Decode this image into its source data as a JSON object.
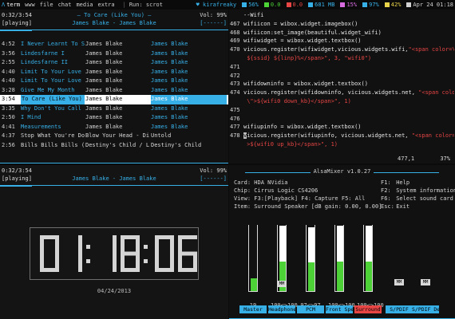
{
  "topbar": {
    "layout_symbol": "Λ",
    "tags": [
      "term",
      "www",
      "file",
      "chat",
      "media",
      "extra"
    ],
    "run_prompt": "Run: scrot",
    "user": "kirafreaky",
    "indicators": [
      {
        "text": "56%",
        "color": "#37b0e8"
      },
      {
        "text": "0.0",
        "color": "#4cd137"
      },
      {
        "text": "0.0",
        "color": "#e84545"
      },
      {
        "text": "681 MB",
        "color": "#37b0e8"
      },
      {
        "text": "15%",
        "color": "#d86be0"
      },
      {
        "text": "97%",
        "color": "#37b0e8"
      },
      {
        "text": "42%",
        "color": "#e8d24a"
      },
      {
        "text": "Apr 24 01:18",
        "color": "#d0d0d0"
      }
    ]
  },
  "music": {
    "time": "0:32/3:54",
    "title": "To Care (Like You)",
    "volume": "Vol: 99%",
    "artist_line": "James Blake - James Blake",
    "status": "[playing]",
    "progress_marker": "[------]",
    "playlist": [
      {
        "time": "4:52",
        "name": "I Never Learnt To Shar",
        "artist": "James Blake",
        "album": "James Blake"
      },
      {
        "time": "3:56",
        "name": "Lindesfarne I",
        "artist": "James Blake",
        "album": "James Blake"
      },
      {
        "time": "2:55",
        "name": "Lindesfarne II",
        "artist": "James Blake",
        "album": "James Blake"
      },
      {
        "time": "4:40",
        "name": "Limit To Your Love",
        "artist": "James Blake",
        "album": "James Blake"
      },
      {
        "time": "4:40",
        "name": "Limit To Your Love",
        "artist": "James Blake",
        "album": "James Blake"
      },
      {
        "time": "3:28",
        "name": "Give Me My Month",
        "artist": "James Blake",
        "album": "James Blake"
      },
      {
        "time": "3:54",
        "name": "To Care (Like You)",
        "artist": "James Blake",
        "album": "James Blake"
      },
      {
        "time": "3:35",
        "name": "Why Don't You Call Me",
        "artist": "James Blake",
        "album": "James Blake"
      },
      {
        "time": "2:50",
        "name": "I Mind",
        "artist": "James Blake",
        "album": "James Blake"
      },
      {
        "time": "4:41",
        "name": "Measurements",
        "artist": "James Blake",
        "album": "James Blake"
      },
      {
        "time": "4:37",
        "name": "Stop What You're Doing",
        "artist": "Blow Your Head - Diplo",
        "album": "Untold"
      },
      {
        "time": "2:56",
        "name": "Bills Bills Bills (Ref",
        "artist": "Destiny's Child / Lil",
        "album": "Destiny's Child"
      }
    ],
    "selected_index": 6
  },
  "music2": {
    "time": "0:32/3:54",
    "volume": "Vol: 99%",
    "artist_line": "James Blake - James Blake",
    "status": "[playing]",
    "progress_marker": "[------]"
  },
  "clock": {
    "digits": "01:18:06",
    "date": "04/24/2013"
  },
  "code": {
    "lines": [
      {
        "n": "",
        "parts": [
          {
            "t": "--Wifi",
            "c": "tx"
          }
        ]
      },
      {
        "n": "467",
        "parts": [
          {
            "t": "wifiicon = wibox.widget.imagebox()",
            "c": "tx"
          }
        ]
      },
      {
        "n": "468",
        "parts": [
          {
            "t": "wifiicon:set_image(beautiful.widget_wifi)",
            "c": "tx"
          }
        ]
      },
      {
        "n": "469",
        "parts": [
          {
            "t": "wifiwidget = wibox.widget.textbox()",
            "c": "tx"
          }
        ]
      },
      {
        "n": "470",
        "parts": [
          {
            "t": "vicious.register(wifiwidget,vicious.widgets.wifi,",
            "c": "tx"
          },
          {
            "t": "\"<span color=\\\"#339dff\\\">",
            "c": "str"
          }
        ]
      },
      {
        "n": "",
        "parts": [
          {
            "t": "  ${ssid} ${linp}%</span>\", 3, \"wifi0\")",
            "c": "str"
          }
        ]
      },
      {
        "n": "471",
        "parts": []
      },
      {
        "n": "472",
        "parts": []
      },
      {
        "n": "473",
        "parts": [
          {
            "t": "wifidowninfo = wibox.widget.textbox()",
            "c": "tx"
          }
        ]
      },
      {
        "n": "474",
        "parts": [
          {
            "t": "vicious.register(wifidowninfo, vicious.widgets.net, ",
            "c": "tx"
          },
          {
            "t": "\"<span color=\\\"#2fffdc",
            "c": "str"
          }
        ]
      },
      {
        "n": "",
        "parts": [
          {
            "t": "  \\\">${wifi0 down_kb}</span>\", 1)",
            "c": "str"
          }
        ]
      },
      {
        "n": "475",
        "parts": []
      },
      {
        "n": "476",
        "parts": []
      },
      {
        "n": "477",
        "parts": [
          {
            "t": "wifiupinfo = wibox.widget.textbox()",
            "c": "tx"
          }
        ]
      },
      {
        "n": "478",
        "parts": [
          {
            "t": "vicious.register(wifiupinfo, vicious.widgets.net, ",
            "c": "tx"
          },
          {
            "t": "\"<span color=\\\"#b93aff\\\"",
            "c": "str"
          }
        ]
      },
      {
        "n": "",
        "parts": [
          {
            "t": "  >${wifi0 up_kb}</span>\", 1)",
            "c": "str"
          }
        ]
      }
    ],
    "cursor_line": 14,
    "status_pos": "477,1",
    "status_pct": "37%"
  },
  "mixer": {
    "title": "AlsaMixer v1.0.27",
    "info": [
      {
        "label": "Card:",
        "value": "HDA NVidia"
      },
      {
        "label": "Chip:",
        "value": "Cirrus Logic CS4206"
      },
      {
        "label": "View:",
        "value": "F3:[Playback] F4: Capture  F5: All"
      },
      {
        "label": "Item:",
        "value": "Surround Speaker [dB gain: 0.00, 0.00]"
      }
    ],
    "keys": [
      {
        "k": "F1:",
        "v": "Help"
      },
      {
        "k": "F2:",
        "v": "System information"
      },
      {
        "k": "F6:",
        "v": "Select sound card"
      },
      {
        "k": "Esc:",
        "v": "Exit"
      }
    ],
    "channels": [
      {
        "name": "Master",
        "value": "19",
        "level": 0.19,
        "mm": false,
        "hot": false
      },
      {
        "name": "Headphone",
        "value": "100<>100",
        "level": 1.0,
        "mm": true,
        "hot": false
      },
      {
        "name": "PCM",
        "value": "97<>97",
        "level": 0.97,
        "mm": false,
        "hot": false
      },
      {
        "name": "Front Spe",
        "value": "100<>100",
        "level": 1.0,
        "mm": false,
        "hot": false
      },
      {
        "name": "Surround",
        "value": "100<>100",
        "level": 1.0,
        "mm": false,
        "hot": true
      },
      {
        "name": "S/PDIF",
        "value": "",
        "level": 0,
        "mm": true,
        "hot": false
      },
      {
        "name": "S/PDIF De",
        "value": "",
        "level": 0,
        "mm": true,
        "hot": false
      }
    ]
  }
}
